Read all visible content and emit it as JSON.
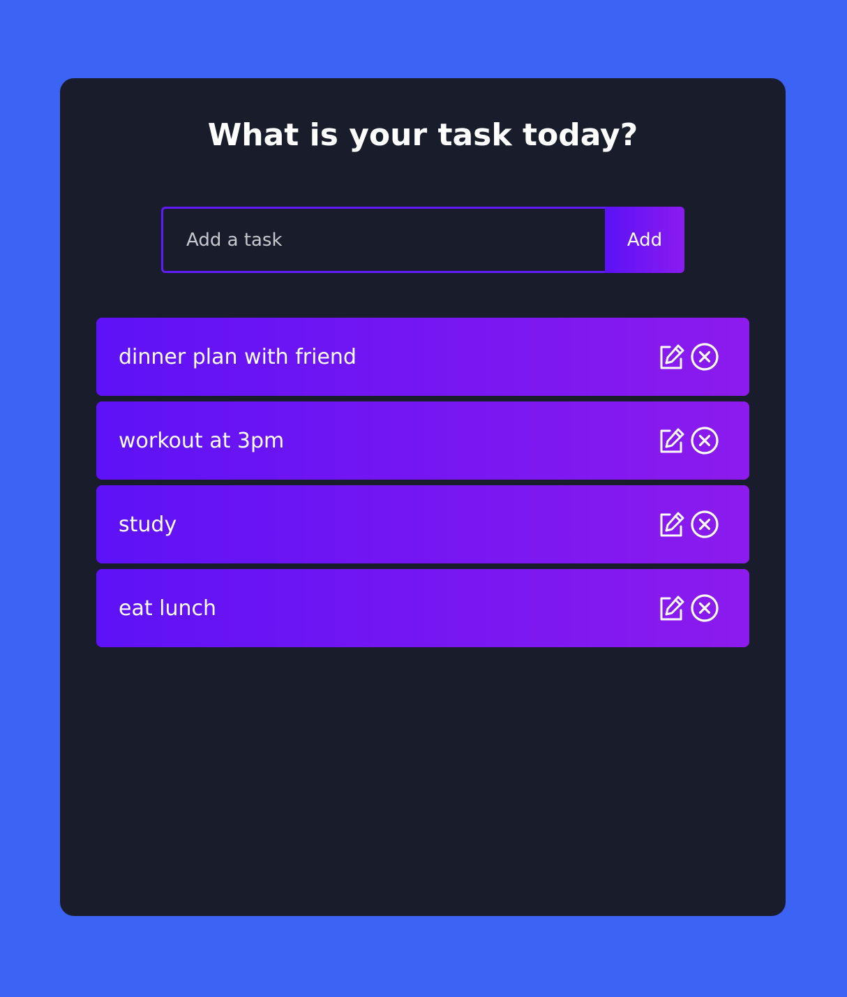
{
  "heading": "What is your task today?",
  "form": {
    "input_value": "",
    "input_placeholder": "Add a task",
    "add_label": "Add"
  },
  "tasks": [
    {
      "text": "dinner plan with friend",
      "edit_icon": "edit-icon",
      "delete_icon": "close-circle-icon"
    },
    {
      "text": "workout at 3pm",
      "edit_icon": "edit-icon",
      "delete_icon": "close-circle-icon"
    },
    {
      "text": "study",
      "edit_icon": "edit-icon",
      "delete_icon": "close-circle-icon"
    },
    {
      "text": "eat lunch",
      "edit_icon": "edit-icon",
      "delete_icon": "close-circle-icon"
    }
  ],
  "colors": {
    "page_background": "#3b63f4",
    "card_background": "#191c2b",
    "accent_start": "#5e12f7",
    "accent_end": "#8c1bee",
    "text": "#ffffff"
  }
}
